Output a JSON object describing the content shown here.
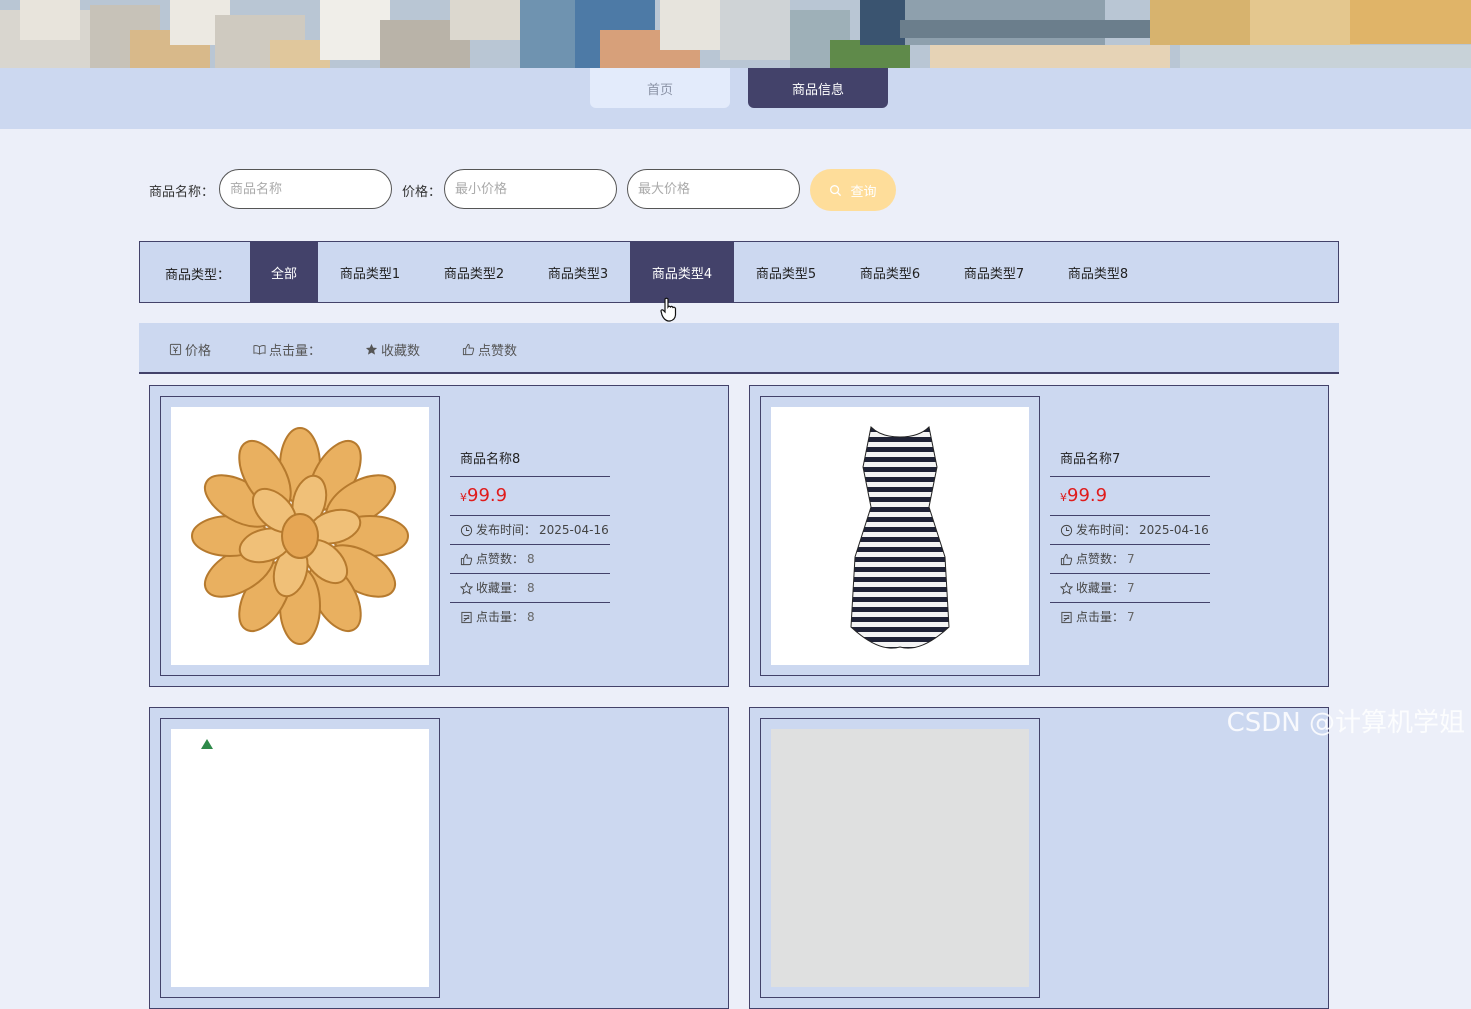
{
  "nav": {
    "home_label": "首页",
    "goods_label": "商品信息"
  },
  "search": {
    "name_label": "商品名称：",
    "name_placeholder": "商品名称",
    "price_label": "价格：",
    "min_placeholder": "最小价格",
    "max_placeholder": "最大价格",
    "button_label": "查询"
  },
  "types": {
    "label": "商品类型：",
    "items": [
      "全部",
      "商品类型1",
      "商品类型2",
      "商品类型3",
      "商品类型4",
      "商品类型5",
      "商品类型6",
      "商品类型7",
      "商品类型8"
    ],
    "active_index": 0,
    "hover_index": 4
  },
  "sort": {
    "items": [
      {
        "icon": "price-tag-icon",
        "label": "价格"
      },
      {
        "icon": "book-icon",
        "label": "点击量："
      },
      {
        "icon": "star-icon",
        "label": "收藏数"
      },
      {
        "icon": "thumbs-up-icon",
        "label": "点赞数"
      }
    ]
  },
  "products": [
    {
      "image_icon": "dried-seafood-image",
      "name": "商品名称8",
      "currency": "¥",
      "price": "99.9",
      "publish_label": "发布时间：",
      "publish_date": "2025-04-16",
      "likes_label": "点赞数：",
      "likes": "8",
      "favorites_label": "收藏量：",
      "favorites": "8",
      "clicks_label": "点击量：",
      "clicks": "8"
    },
    {
      "image_icon": "striped-dress-image",
      "name": "商品名称7",
      "currency": "¥",
      "price": "99.9",
      "publish_label": "发布时间：",
      "publish_date": "2025-04-16",
      "likes_label": "点赞数：",
      "likes": "7",
      "favorites_label": "收藏量：",
      "favorites": "7",
      "clicks_label": "点击量：",
      "clicks": "7"
    }
  ],
  "watermark": "CSDN @计算机学姐",
  "colors": {
    "primary": "#43426a",
    "panel": "#ccd8f0",
    "background": "#eceff9",
    "price": "#e01b1b",
    "search_button": "#fedd9a"
  }
}
